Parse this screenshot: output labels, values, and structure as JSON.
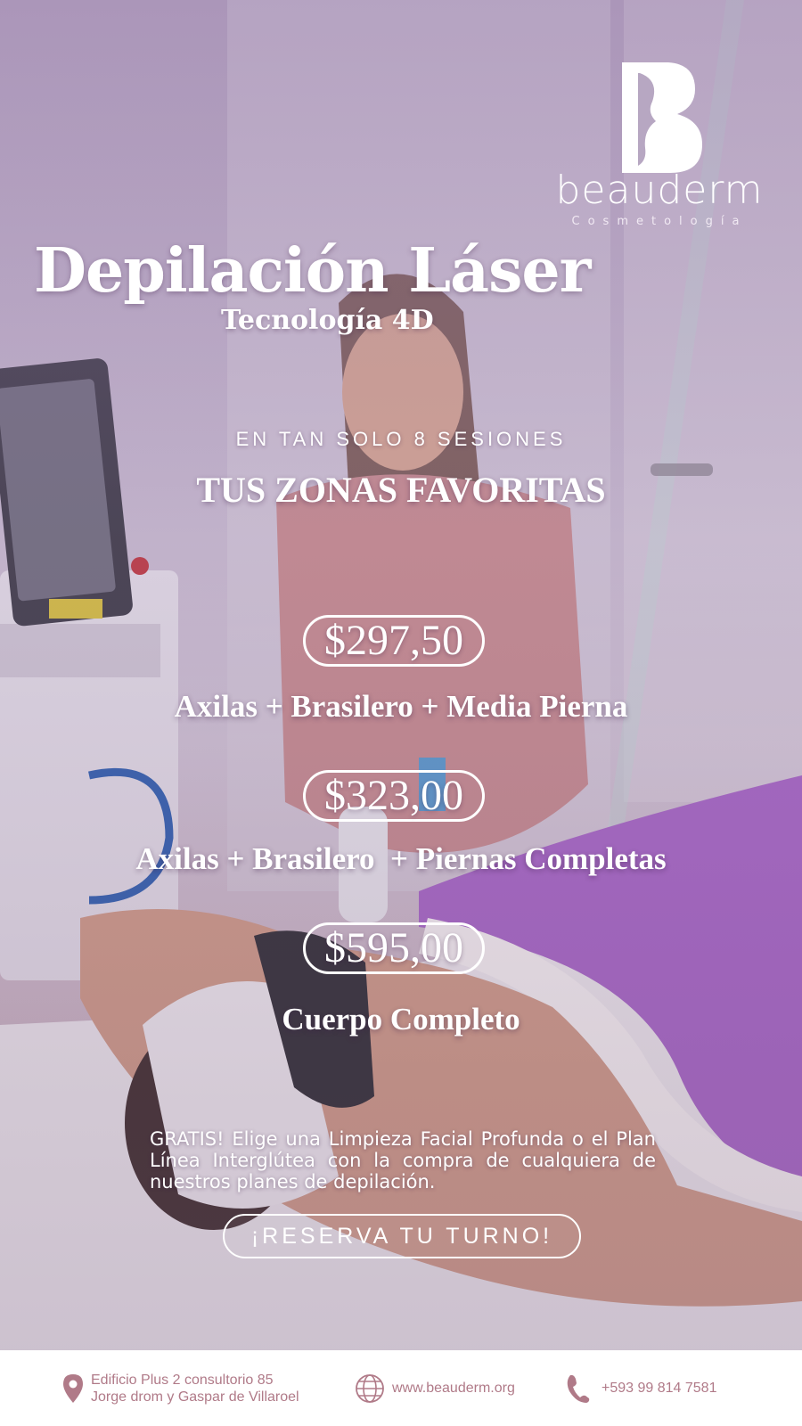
{
  "brand": {
    "name": "beauderm",
    "tagline": "Cosmetología"
  },
  "hero": {
    "title": "Depilación Láser",
    "subtitle": "Tecnología 4D",
    "tagline": "EN TAN SOLO 8 SESIONES",
    "section_title": "TUS ZONAS FAVORITAS"
  },
  "plans": [
    {
      "price": "$297,50",
      "description": "Axilas + Brasilero + Media Pierna"
    },
    {
      "price": "$323,00",
      "description": "Axilas + Brasilero  + Piernas Completas"
    },
    {
      "price": "$595,00",
      "description": "Cuerpo Completo"
    }
  ],
  "promo": {
    "text": "GRATIS! Elige una Limpieza Facial Profunda o el Plan Línea Interglútea con la compra de cualquiera de nuestros planes de depilación."
  },
  "cta": {
    "label": "¡RESERVA TU TURNO!"
  },
  "footer": {
    "address_line1": "Edificio Plus 2 consultorio 85",
    "address_line2": "Jorge drom y Gaspar de Villaroel",
    "website": "www.beauderm.org",
    "phone": "+593 99 814 7581",
    "icons": [
      "location-pin-icon",
      "globe-icon",
      "phone-icon"
    ]
  },
  "colors": {
    "overlay": "#9b7fae",
    "footer_text": "#b07a88",
    "towel": "#a866c8"
  }
}
